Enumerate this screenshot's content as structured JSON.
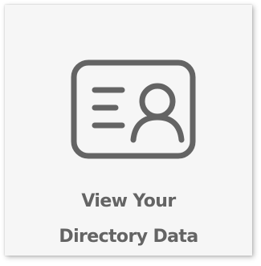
{
  "tile": {
    "label_line1": "View Your",
    "label_line2": "Directory Data",
    "icon": "id-card-icon"
  },
  "colors": {
    "background": "#ffffff",
    "tile_background": "#f6f6f6",
    "icon_stroke": "#646464",
    "label_text": "#646464"
  }
}
